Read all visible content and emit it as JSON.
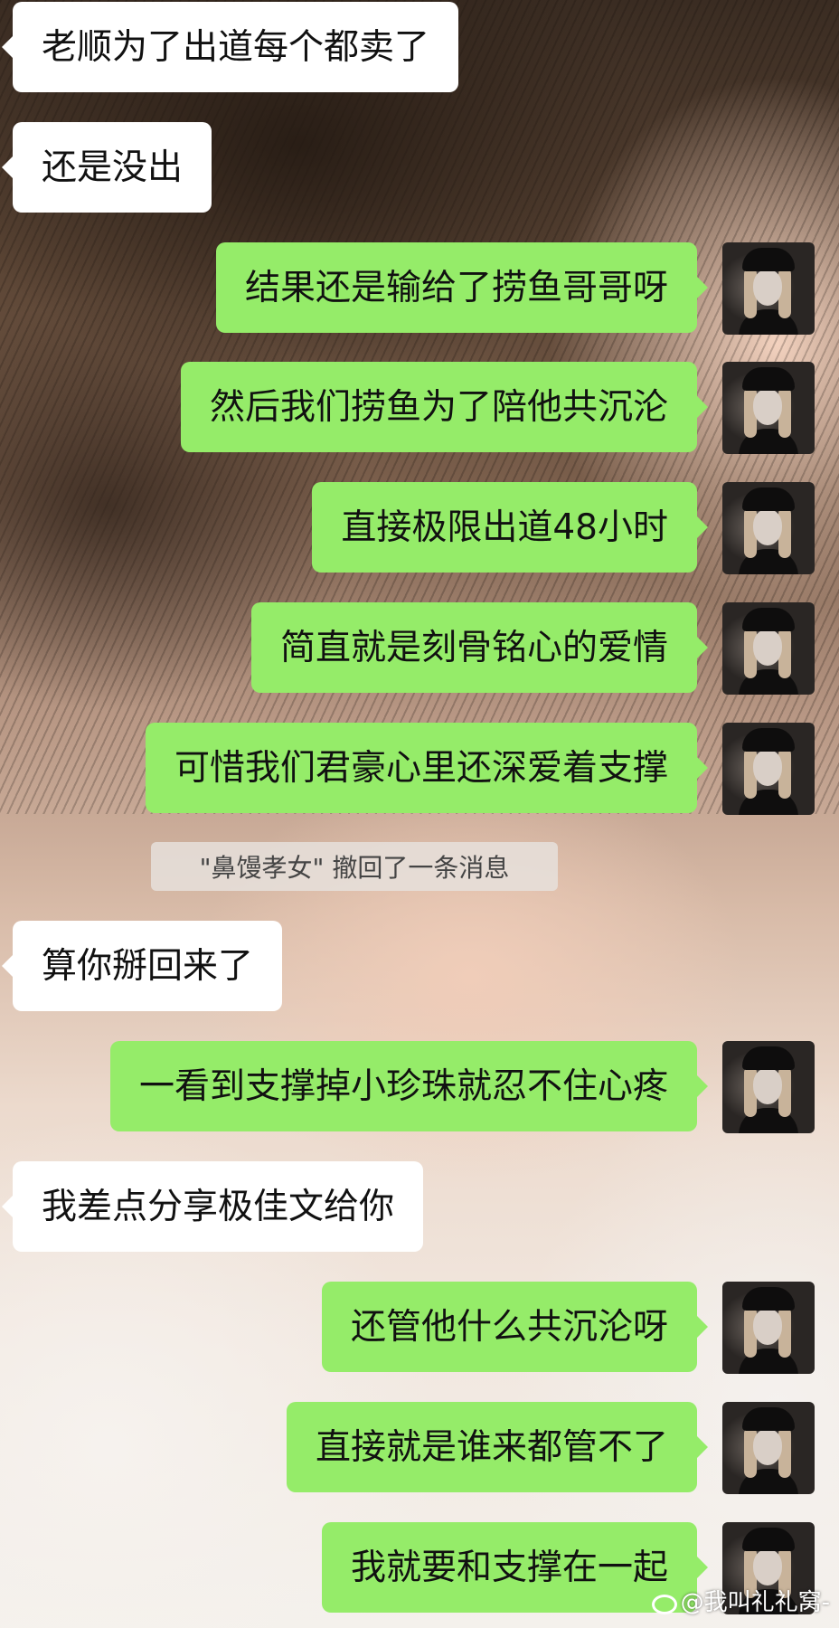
{
  "messages": [
    {
      "side": "left",
      "text": "老顺为了出道每个都卖了"
    },
    {
      "side": "left",
      "text": "还是没出"
    },
    {
      "side": "right",
      "text": "结果还是输给了捞鱼哥哥呀"
    },
    {
      "side": "right",
      "text": "然后我们捞鱼为了陪他共沉沦"
    },
    {
      "side": "right",
      "text": "直接极限出道48小时"
    },
    {
      "side": "right",
      "text": "简直就是刻骨铭心的爱情"
    },
    {
      "side": "right",
      "text": "可惜我们君豪心里还深爱着支撑"
    },
    {
      "side": "left",
      "text": "算你掰回来了"
    },
    {
      "side": "right",
      "text": "一看到支撑掉小珍珠就忍不住心疼"
    },
    {
      "side": "left",
      "text": "我差点分享极佳文给你"
    },
    {
      "side": "right",
      "text": "还管他什么共沉沦呀"
    },
    {
      "side": "right",
      "text": "直接就是谁来都管不了"
    },
    {
      "side": "right",
      "text": "我就要和支撑在一起"
    }
  ],
  "system_notice": "\"鼻馒孝女\" 撤回了一条消息",
  "watermark": "@我叫礼礼窝-",
  "colors": {
    "sent_bubble": "#95ec69",
    "received_bubble": "#ffffff"
  }
}
